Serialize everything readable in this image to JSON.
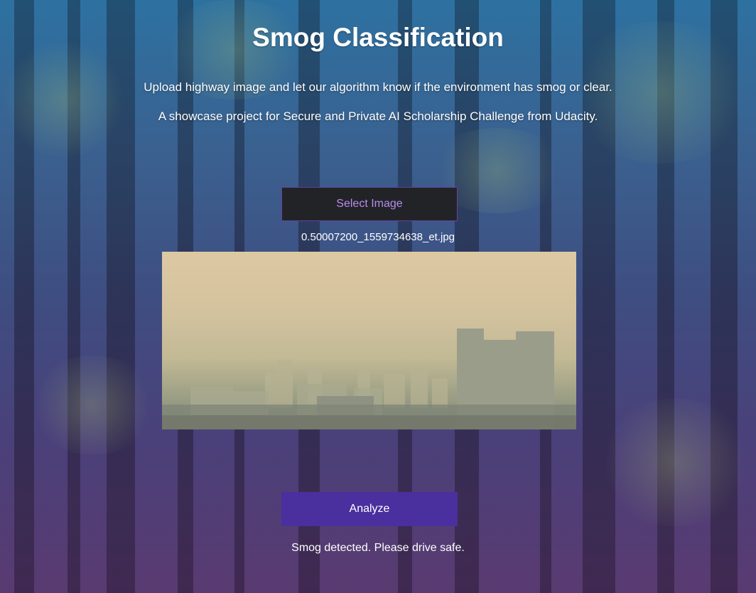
{
  "page": {
    "title": "Smog Classification",
    "description_1": "Upload highway image and let our algorithm know if the environment has smog or clear.",
    "description_2": "A showcase project for Secure and Private AI Scholarship Challenge from Udacity."
  },
  "upload": {
    "select_label": "Select Image",
    "filename": "0.50007200_1559734638_et.jpg",
    "preview_icon": "smoggy-city-photo"
  },
  "analyze": {
    "button_label": "Analyze",
    "result_text": "Smog detected. Please drive safe."
  },
  "colors": {
    "select_button_bg": "#222327",
    "select_button_text": "#b98cf0",
    "select_button_border": "#6b3fa0",
    "analyze_button_bg": "#4a2f9e",
    "text": "#ffffff"
  }
}
